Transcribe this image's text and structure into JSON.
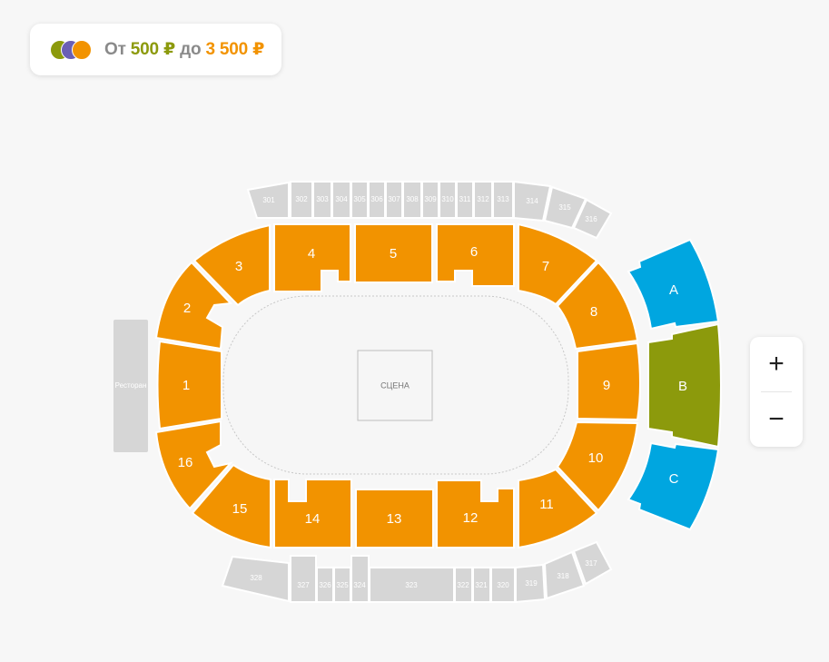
{
  "price_range": {
    "from_label": "От",
    "min": "500 ₽",
    "to_label": "до",
    "max": "3 500 ₽"
  },
  "legend_colors": [
    "#8c9a0c",
    "#6a5fb5",
    "#f29300"
  ],
  "colors": {
    "orange_sections": "#f29300",
    "green_sector": "#8c9a0c",
    "blue_sectors": "#00a6e0",
    "unavailable": "#d6d6d6"
  },
  "map": {
    "stage_label": "СЦЕНА",
    "restaurant_label": "Ресторан",
    "lower_sections": [
      "1",
      "2",
      "3",
      "4",
      "5",
      "6",
      "7",
      "8",
      "9",
      "10",
      "11",
      "12",
      "13",
      "14",
      "15",
      "16"
    ],
    "vip_sectors": [
      "A",
      "B",
      "C"
    ],
    "upper_top": [
      "301",
      "302",
      "303",
      "304",
      "305",
      "306",
      "307",
      "308",
      "309",
      "310",
      "311",
      "312",
      "313",
      "314",
      "315",
      "316"
    ],
    "upper_bottom": [
      "317",
      "318",
      "319",
      "320",
      "321",
      "322",
      "323",
      "324",
      "325",
      "326",
      "327",
      "328"
    ]
  },
  "zoom": {
    "in_label": "+",
    "out_label": "−"
  }
}
